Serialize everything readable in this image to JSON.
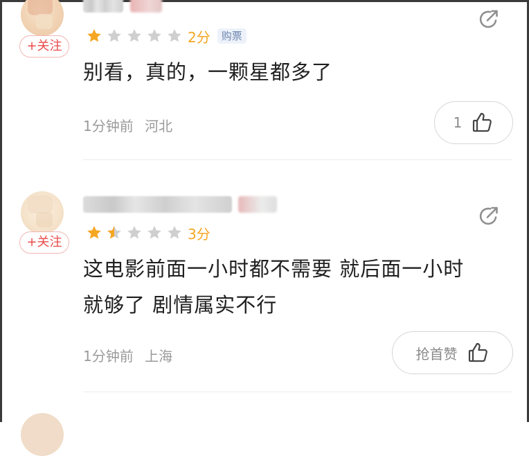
{
  "colors": {
    "star_filled": "#f5a623",
    "star_empty": "#cfcfcf",
    "follow_red": "#e94b4b",
    "meta_gray": "#9a9a9a",
    "tag_blue": "#6f87b0"
  },
  "comments": [
    {
      "follow_label": "+关注",
      "rating": 1,
      "score_label": "2分",
      "tag": "购票",
      "text": "别看，真的，一颗星都多了",
      "time": "1分钟前",
      "location": "河北",
      "like_label": "1",
      "share_icon": "share-icon",
      "like_icon": "thumbs-up-icon"
    },
    {
      "follow_label": "+关注",
      "rating": 1.5,
      "score_label": "3分",
      "text_line1": "这电影前面一小时都不需要 就后面一小时",
      "text_line2": "就够了 剧情属实不行",
      "time": "1分钟前",
      "location": "上海",
      "like_label": "抢首赞",
      "share_icon": "share-icon",
      "like_icon": "thumbs-up-icon"
    }
  ]
}
